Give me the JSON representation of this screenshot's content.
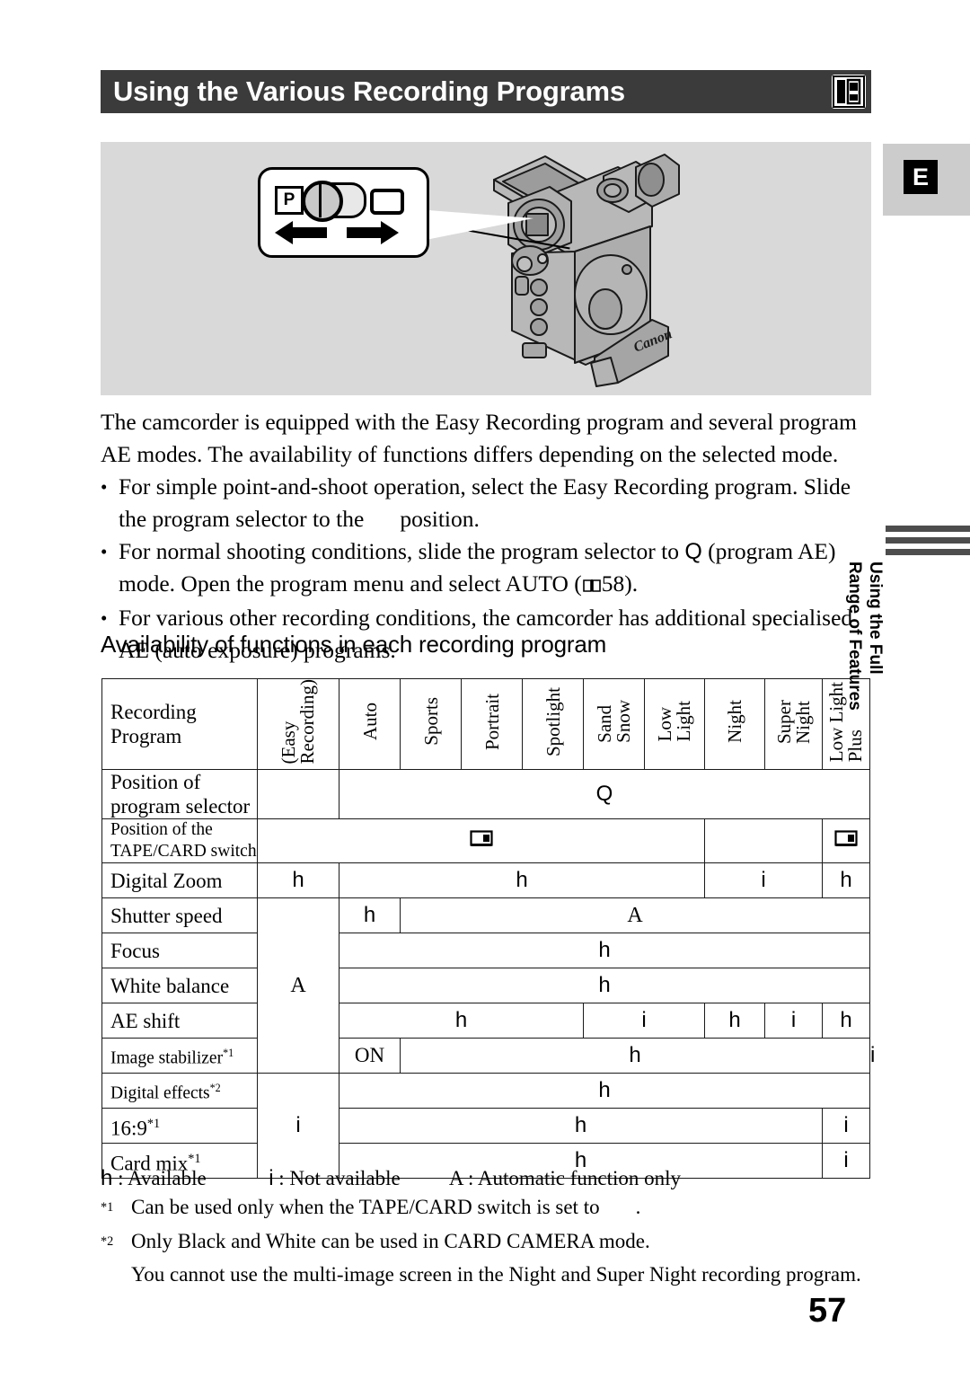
{
  "header": {
    "title": "Using the Various Recording Programs",
    "icon": "book-camera-icon"
  },
  "lang_marker": {
    "label": "E"
  },
  "illustration": {
    "callout": {
      "p_label": "P",
      "left_arrow": "arrow-left-icon",
      "right_arrow": "arrow-right-icon",
      "easy_icon": "easy-recording-icon"
    },
    "device": {
      "brand": "Canon",
      "name": "camcorder-illustration"
    }
  },
  "body": {
    "intro": "The camcorder is equipped with the Easy Recording program and several program AE modes. The availability of functions differs depending on the selected mode.",
    "bullets": [
      {
        "dot": "•",
        "part1": "For simple point-and-shoot operation, select the Easy Recording program. Slide the program selector to the",
        "part2": "position."
      },
      {
        "dot": "•",
        "part1": "For normal shooting conditions, slide the program selector to",
        "q": "Q",
        "part2": "(program AE) mode. Open the program menu and select AUTO (",
        "page_ref": "58",
        "part3": ")."
      },
      {
        "dot": "•",
        "part1": "For various other recording conditions, the camcorder has additional specialised AE (auto exposure) programs.",
        "part2": ""
      }
    ]
  },
  "subheading": "Availability of functions in each recording program",
  "side_tab": {
    "line1": "Using the Full",
    "line2": "Range of Features"
  },
  "table": {
    "corner_label_line1": "Recording",
    "corner_label_line2": "Program",
    "columns": [
      "(Easy\nRecording)",
      "Auto",
      "Sports",
      "Portrait",
      "Spotlight",
      "Sand\nSnow",
      "Low\nLight",
      "Night",
      "Super\nNight",
      "Low Light\nPlus"
    ],
    "rows": [
      {
        "label_line1": "Position of",
        "label_line2": "program selector",
        "cells": [
          {
            "text": "",
            "span": 1
          },
          {
            "text": "Q",
            "span": 9,
            "style": "symbol"
          }
        ]
      },
      {
        "label_line1": "Position of the",
        "label_line2": "TAPE/CARD switch",
        "label_small": true,
        "cells": [
          {
            "text": "tape-icon",
            "span": 7,
            "style": "icon"
          },
          {
            "text": "",
            "span": 2
          },
          {
            "text": "tape-icon",
            "span": 1,
            "style": "icon"
          }
        ]
      },
      {
        "label_line1": "Digital Zoom",
        "cells": [
          {
            "text": "h",
            "span": 1,
            "style": "symbol"
          },
          {
            "text": "h",
            "span": 6,
            "style": "symbol"
          },
          {
            "text": "i",
            "span": 2,
            "style": "symbol"
          },
          {
            "text": "h",
            "span": 1,
            "style": "symbol"
          }
        ]
      },
      {
        "label_line1": "Shutter speed",
        "cells": [
          {
            "text": "A",
            "span": 1,
            "style": "auto",
            "rowspan": 5
          },
          {
            "text": "h",
            "span": 1,
            "style": "symbol"
          },
          {
            "text": "A",
            "span": 8,
            "style": "auto"
          }
        ]
      },
      {
        "label_line1": "Focus",
        "cells": [
          {
            "text": "h",
            "span": 9,
            "style": "symbol"
          }
        ]
      },
      {
        "label_line1": "White balance",
        "cells": [
          {
            "text": "h",
            "span": 9,
            "style": "symbol"
          }
        ]
      },
      {
        "label_line1": "AE shift",
        "cells": [
          {
            "text": "h",
            "span": 4,
            "style": "symbol"
          },
          {
            "text": "i",
            "span": 2,
            "style": "symbol"
          },
          {
            "text": "h",
            "span": 1,
            "style": "symbol"
          },
          {
            "text": "i",
            "span": 1,
            "style": "symbol"
          },
          {
            "text": "h",
            "span": 1,
            "style": "symbol"
          }
        ]
      },
      {
        "label_line1": "Image stabilizer*1",
        "label_small": true,
        "cells": [
          {
            "text": "ON",
            "span": 1,
            "style": "on"
          },
          {
            "text": "h",
            "span": 8,
            "style": "symbol"
          },
          {
            "text": "i",
            "span": 1,
            "style": "symbol"
          }
        ]
      },
      {
        "label_line1": "Digital effects*2",
        "label_small": true,
        "cells": [
          {
            "text": "i",
            "span": 1,
            "style": "symbol",
            "rowspan": 3
          },
          {
            "text": "h",
            "span": 9,
            "style": "symbol"
          }
        ]
      },
      {
        "label_line1": "16:9*1",
        "cells": [
          {
            "text": "h",
            "span": 8,
            "style": "symbol"
          },
          {
            "text": "i",
            "span": 1,
            "style": "symbol"
          }
        ]
      },
      {
        "label_line1": "Card mix*1",
        "cells": [
          {
            "text": "h",
            "span": 8,
            "style": "symbol"
          },
          {
            "text": "i",
            "span": 1,
            "style": "symbol"
          }
        ]
      }
    ]
  },
  "footnotes": {
    "legend_available_sym": "h",
    "legend_available": ": Available",
    "legend_not_sym": "i",
    "legend_not": ": Not available",
    "legend_auto_sym": "A",
    "legend_auto": ": Automatic function only",
    "note1_mark": "*1",
    "note1": "Can be used only when the TAPE/CARD switch is set to",
    "note1_tail": ".",
    "note2_mark": "*2",
    "note2": "Only Black and White can be used in CARD CAMERA mode.",
    "note2_cont": "You cannot use the multi-image screen in the Night and Super Night recording program."
  },
  "page_number": "57"
}
